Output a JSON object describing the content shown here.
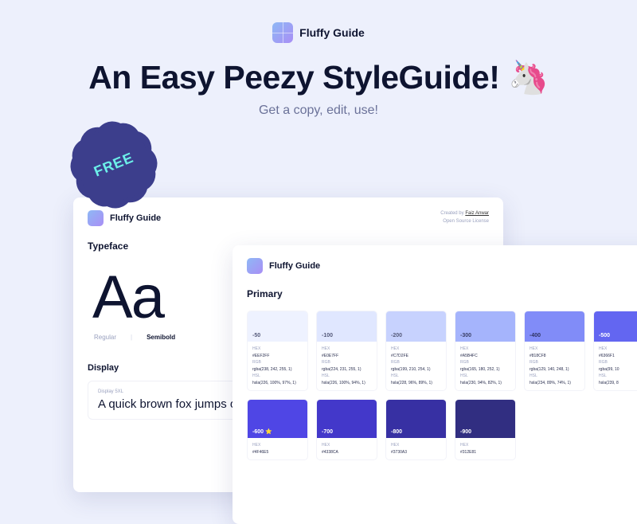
{
  "brand": {
    "name": "Fluffy Guide"
  },
  "headline": "An Easy Peezy StyleGuide! 🦄",
  "subhead": "Get a copy, edit, use!",
  "badge": {
    "text": "FREE"
  },
  "card_a": {
    "title": "Fluffy Guide",
    "created_label": "Created by ",
    "author": "Faiz Anwar",
    "license": "Open Source License",
    "section": "Typeface",
    "aa": "Aa",
    "weights": [
      "Regular",
      "Semibold"
    ],
    "display_section": "Display",
    "display_tag": "Display 5XL",
    "display_sample": "A quick brown fox jumps o"
  },
  "card_b": {
    "title": "Fluffy Guide",
    "section": "Primary",
    "row1": [
      {
        "step": "-50",
        "hex": "#EEF2FF",
        "rgb": "rgba(238, 242, 255, 1)",
        "hsl": "hsla(226, 100%, 97%, 1)",
        "chip": "#EEF2FF",
        "text": "#555A7A"
      },
      {
        "step": "-100",
        "hex": "#E0E7FF",
        "rgb": "rgba(224, 231, 255, 1)",
        "hsl": "hsla(226, 100%, 94%, 1)",
        "chip": "#E0E7FF",
        "text": "#555A7A"
      },
      {
        "step": "-200",
        "hex": "#C7D2FE",
        "rgb": "rgba(199, 210, 254, 1)",
        "hsl": "hsla(228, 96%, 89%, 1)",
        "chip": "#C7D2FE",
        "text": "#555A7A"
      },
      {
        "step": "-300",
        "hex": "#A5B4FC",
        "rgb": "rgba(165, 180, 252, 1)",
        "hsl": "hsla(230, 94%, 82%, 1)",
        "chip": "#A5B4FC",
        "text": "#3A3F66"
      },
      {
        "step": "-400",
        "hex": "#818CF8",
        "rgb": "rgba(129, 140, 248, 1)",
        "hsl": "hsla(234, 89%, 74%, 1)",
        "chip": "#818CF8",
        "text": "#2F3362"
      },
      {
        "step": "-500",
        "hex": "#6366F1",
        "rgb": "rgba(99, 10",
        "hsl": "hsla(239, 8",
        "chip": "#6366F1",
        "text": "#fff"
      }
    ],
    "row2": [
      {
        "step": "-600 ⭐",
        "hex": "#4F46E5",
        "chip": "#4F46E5"
      },
      {
        "step": "-700",
        "hex": "#4338CA",
        "chip": "#4338CA"
      },
      {
        "step": "-800",
        "hex": "#3730A3",
        "chip": "#3730A3"
      },
      {
        "step": "-900",
        "hex": "#312E81",
        "chip": "#312E81"
      }
    ]
  }
}
